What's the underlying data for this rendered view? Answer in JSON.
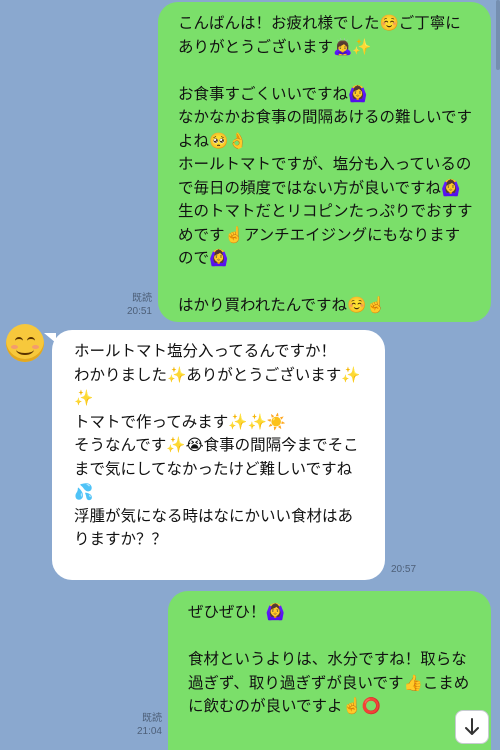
{
  "messages": [
    {
      "direction": "outgoing",
      "read_label": "既読",
      "time": "20:51",
      "text": "こんばんは！お疲れ様でした☺️ご丁寧にありがとうございます🙇‍♀️✨\n\nお食事すごくいいですね🙆‍♀️\nなかなかお食事の間隔あけるの難しいですよね🥺👌\nホールトマトですが、塩分も入っているので毎日の頻度ではない方が良いですね🙆‍♀️生のトマトだとリコピンたっぷりでおすすめです☝️アンチエイジングにもなりますので🙆‍♀️\n\nはかり買われたんですね☺️☝️"
    },
    {
      "direction": "incoming",
      "time": "20:57",
      "avatar": "smiling-face-avatar",
      "text": "ホールトマト塩分入ってるんですか！\nわかりました✨ありがとうございます✨✨\nトマトで作ってみます✨✨☀️\nそうなんです✨😭食事の間隔今までそこまで気にしてなかったけど難しいですね💦\n浮腫が気になる時はなにかいい食材はありますか？？"
    },
    {
      "direction": "outgoing",
      "read_label": "既読",
      "time": "21:04",
      "text": "ぜひぜひ！🙆‍♀️\n\n食材というよりは、水分ですね！取らな過ぎず、取り過ぎずが良いです👍こまめに飲むのが良いですよ☝️⭕"
    }
  ],
  "scroll_button_icon": "arrow-down-icon",
  "colors": {
    "background": "#8aa8cf",
    "outgoing_bubble": "#7bdf6a",
    "incoming_bubble": "#ffffff"
  }
}
